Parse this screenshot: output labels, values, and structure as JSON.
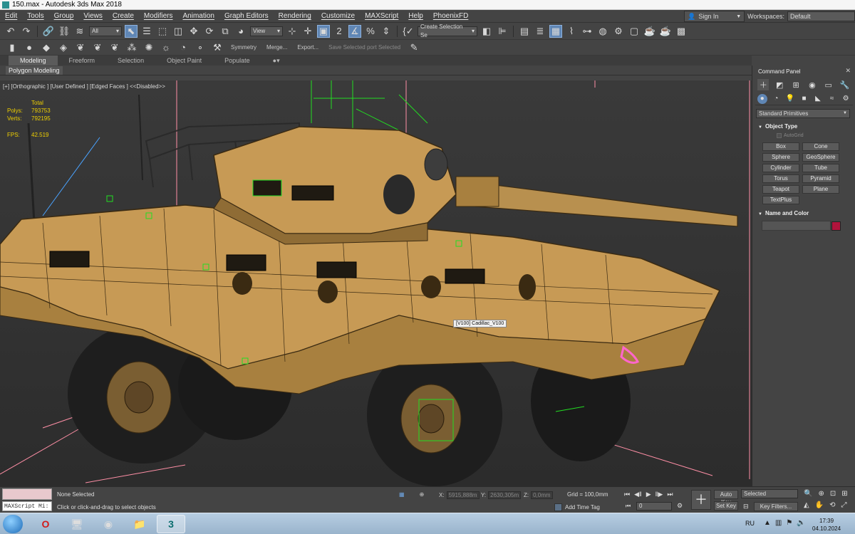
{
  "window": {
    "title": "150.max - Autodesk 3ds Max 2018"
  },
  "menu": {
    "items": [
      "Edit",
      "Tools",
      "Group",
      "Views",
      "Create",
      "Modifiers",
      "Animation",
      "Graph Editors",
      "Rendering",
      "Customize",
      "MAXScript",
      "Help",
      "PhoenixFD"
    ],
    "sign_in": "Sign In",
    "workspaces_label": "Workspaces:",
    "workspaces_value": "Default"
  },
  "toolbar": {
    "filter_value": "All",
    "view_value": "View",
    "selection_set_placeholder": "Create Selection Se",
    "symmetry": "Symmetry",
    "merge": "Merge...",
    "export": "Export...",
    "save_selected": "Save Selected port Selected"
  },
  "ribbon": {
    "tabs": [
      "Modeling",
      "Freeform",
      "Selection",
      "Object Paint",
      "Populate"
    ],
    "active_tab": "Modeling",
    "panel_label": "Polygon Modeling"
  },
  "viewport": {
    "label": "[+] [Orthographic ] [User Defined ] [Edged Faces ]  <<Disabled>>",
    "stats": {
      "header": "Total",
      "polys_label": "Polys:",
      "polys": "793753",
      "verts_label": "Verts:",
      "verts": "792195",
      "fps_label": "FPS:",
      "fps": "42.519"
    },
    "tooltip": "[V100] Cadillac_V100",
    "colors": {
      "model": "#c79a55",
      "wire": "#3a2a12",
      "helper_green": "#22dd22",
      "helper_magenta": "#ff66cc",
      "grid_pink": "#ff8fa6"
    }
  },
  "command_panel": {
    "title": "Command Panel",
    "category": "Standard Primitives",
    "object_type_header": "Object Type",
    "autogrid": "AutoGrid",
    "buttons": [
      "Box",
      "Cone",
      "Sphere",
      "GeoSphere",
      "Cylinder",
      "Tube",
      "Torus",
      "Pyramid",
      "Teapot",
      "Plane",
      "TextPlus"
    ],
    "name_color_header": "Name and Color",
    "swatch_color": "#b0143c"
  },
  "status": {
    "script_label": "MAXScript Mi:",
    "selection": "None Selected",
    "prompt": "Click or click-and-drag to select objects",
    "x_label": "X:",
    "x": "5915,888m",
    "y_label": "Y:",
    "y": "2630,305m",
    "z_label": "Z:",
    "z": "0,0mm",
    "grid": "Grid = 100,0mm",
    "add_time_tag": "Add Time Tag",
    "frame": "0",
    "auto_key": "Auto Key",
    "set_key": "Set Key",
    "selected": "Selected",
    "key_filters": "Key Filters..."
  },
  "taskbar": {
    "lang": "RU",
    "time": "17:39",
    "date": "04.10.2024",
    "app_badge": "3"
  }
}
